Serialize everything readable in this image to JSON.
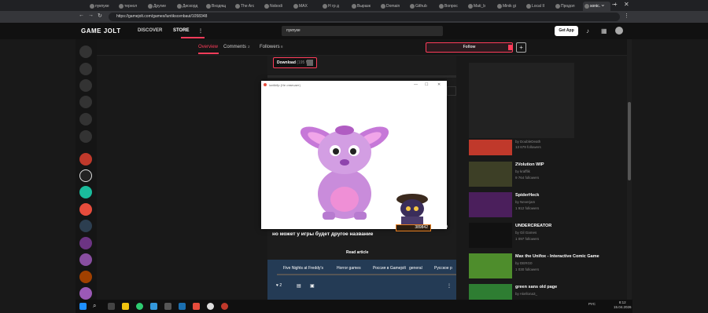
{
  "browser": {
    "tabs": [
      {
        "label": "пукпуке",
        "active": false
      },
      {
        "label": "тернол",
        "active": false
      },
      {
        "label": "Другие",
        "active": false
      },
      {
        "label": "Дискорд",
        "active": false
      },
      {
        "label": "Входящ",
        "active": false
      },
      {
        "label": "The Arc",
        "active": false
      },
      {
        "label": "Nobodi",
        "active": false
      },
      {
        "label": "MAX",
        "active": false
      },
      {
        "label": "Н гр д",
        "active": false
      },
      {
        "label": "Выразк",
        "active": false
      },
      {
        "label": "Domain",
        "active": false
      },
      {
        "label": "Github",
        "active": false
      },
      {
        "label": "Вопрос",
        "active": false
      },
      {
        "label": "Mati_b",
        "active": false
      },
      {
        "label": "Minik gi",
        "active": false
      },
      {
        "label": "Local II",
        "active": false
      },
      {
        "label": "Продол",
        "active": false
      },
      {
        "label": "sonic.",
        "active": true
      }
    ],
    "new_tab": "+",
    "url": "https://gamejolt.com/games/luntikscenbaut/1058348"
  },
  "site": {
    "logo": "GAME JOLT",
    "nav": {
      "discover": "DISCOVER",
      "store": "STORE",
      "more": "⋮"
    },
    "search_value": "пукпуке",
    "get_app": "Get App"
  },
  "subnav": {
    "overview": "Overview",
    "comments": "Comments",
    "comments_count": "2",
    "followers": "Followers",
    "followers_count": "8",
    "follow": "Follow",
    "plus": "+"
  },
  "main": {
    "download": "Download",
    "download_size": "(195 МБ)",
    "article": "новая игра | финал перезагрузка охранение сохранение бугом ориса но может у игры будет другое название",
    "read_article": "Read article",
    "tags": [
      "Five Nights at Freddy's",
      "Horror games",
      "Россия в Gamejolt",
      "general",
      "Русское р"
    ],
    "likes": "2"
  },
  "popup": {
    "title": "luntikflp (Не отвечает)",
    "counter": "389842"
  },
  "right": {
    "items": [
      {
        "title": "",
        "author": "by DoubleDeath",
        "followers": "13 679 followers",
        "color": "#c0392b"
      },
      {
        "title": "2Volution WIP",
        "author": "by krafflik",
        "followers": "9 764 followers",
        "color": "#3d3f26"
      },
      {
        "title": "SpiderHeck",
        "author": "by Neverjam",
        "followers": "1 912 followers",
        "color": "#4b1f5c"
      },
      {
        "title": "UNDERCREATOR",
        "author": "by Gil Games",
        "followers": "1 097 followers",
        "color": "#111111"
      },
      {
        "title": "Max the Unifox - Interactive Comic Game",
        "author": "by DERG0",
        "followers": "1 030 followers",
        "color": "#4e8d2c"
      },
      {
        "title": "green sans old page",
        "author": "by Akellona3_",
        "followers": "",
        "color": "#2e7d32"
      }
    ]
  },
  "taskbar": {
    "tray": "РУС",
    "time": "8:12",
    "date": "15.04.2026"
  }
}
